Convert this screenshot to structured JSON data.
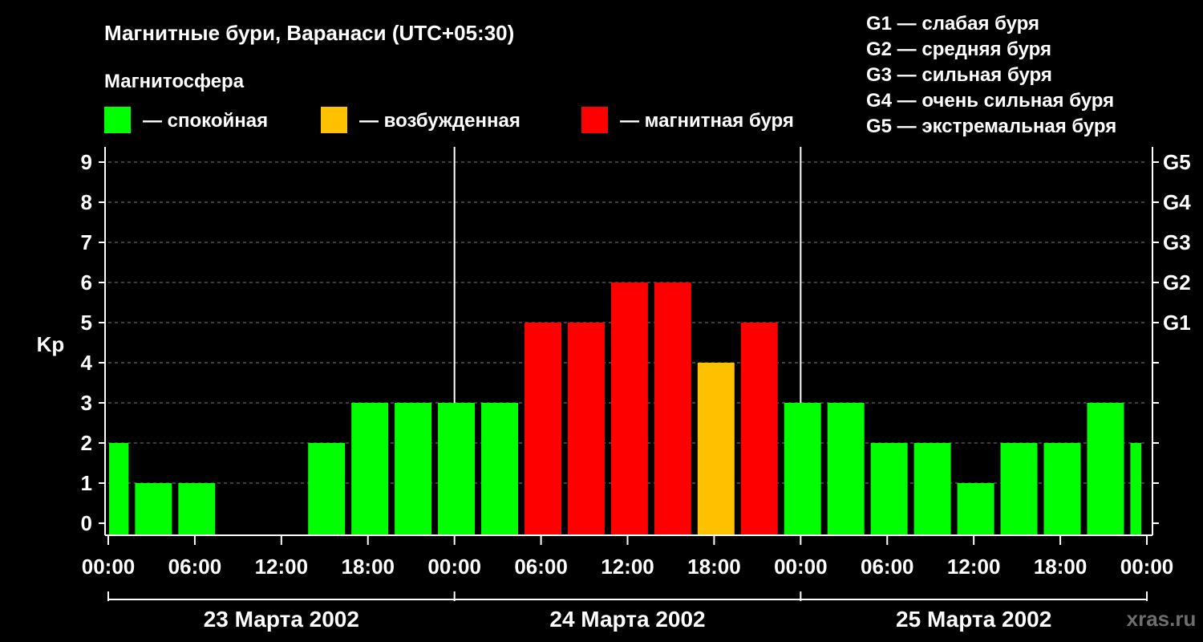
{
  "chart_data": {
    "type": "bar",
    "title": "Магнитные бури, Варанаси (UTC+05:30)",
    "subtitle": "Магнитосфера",
    "ylabel": "Kp",
    "ylim": [
      0,
      9
    ],
    "yticks": [
      "0",
      "1",
      "2",
      "3",
      "4",
      "5",
      "6",
      "7",
      "8",
      "9"
    ],
    "right_ticks": [
      {
        "kp": 5,
        "label": "G1"
      },
      {
        "kp": 6,
        "label": "G2"
      },
      {
        "kp": 7,
        "label": "G3"
      },
      {
        "kp": 8,
        "label": "G4"
      },
      {
        "kp": 9,
        "label": "G5"
      }
    ],
    "legend": [
      {
        "label": "— спокойная",
        "color": "#00ff00"
      },
      {
        "label": "— возбужденная",
        "color": "#ffc000"
      },
      {
        "label": "— магнитная буря",
        "color": "#ff0000"
      }
    ],
    "g_legend": [
      "G1 — слабая буря",
      "G2 — средняя буря",
      "G3 — сильная буря",
      "G4 — очень сильная буря",
      "G5 — экстремальная буря"
    ],
    "x_range_hours": [
      0,
      72
    ],
    "xticks": [
      "00:00",
      "06:00",
      "12:00",
      "18:00",
      "00:00",
      "06:00",
      "12:00",
      "18:00",
      "00:00",
      "06:00",
      "12:00",
      "18:00",
      "00:00"
    ],
    "days": [
      "23 Марта 2002",
      "24 Марта 2002",
      "25 Марта 2002"
    ],
    "bars": [
      {
        "start": 0,
        "end": 1.8,
        "kp": 2,
        "level": "quiet"
      },
      {
        "start": 1.8,
        "end": 4.8,
        "kp": 1,
        "level": "quiet"
      },
      {
        "start": 4.8,
        "end": 7.8,
        "kp": 1,
        "level": "quiet"
      },
      {
        "start": 7.8,
        "end": 10.8,
        "kp": 0,
        "level": "quiet"
      },
      {
        "start": 10.8,
        "end": 13.8,
        "kp": 0,
        "level": "quiet"
      },
      {
        "start": 13.8,
        "end": 16.8,
        "kp": 2,
        "level": "quiet"
      },
      {
        "start": 16.8,
        "end": 19.8,
        "kp": 3,
        "level": "quiet"
      },
      {
        "start": 19.8,
        "end": 22.8,
        "kp": 3,
        "level": "quiet"
      },
      {
        "start": 22.8,
        "end": 25.8,
        "kp": 3,
        "level": "quiet"
      },
      {
        "start": 25.8,
        "end": 28.8,
        "kp": 3,
        "level": "quiet"
      },
      {
        "start": 28.8,
        "end": 31.8,
        "kp": 5,
        "level": "storm"
      },
      {
        "start": 31.8,
        "end": 34.8,
        "kp": 5,
        "level": "storm"
      },
      {
        "start": 34.8,
        "end": 37.8,
        "kp": 6,
        "level": "storm"
      },
      {
        "start": 37.8,
        "end": 40.8,
        "kp": 6,
        "level": "storm"
      },
      {
        "start": 40.8,
        "end": 43.8,
        "kp": 4,
        "level": "active"
      },
      {
        "start": 43.8,
        "end": 46.8,
        "kp": 5,
        "level": "storm"
      },
      {
        "start": 46.8,
        "end": 49.8,
        "kp": 3,
        "level": "quiet"
      },
      {
        "start": 49.8,
        "end": 52.8,
        "kp": 3,
        "level": "quiet"
      },
      {
        "start": 52.8,
        "end": 55.8,
        "kp": 2,
        "level": "quiet"
      },
      {
        "start": 55.8,
        "end": 58.8,
        "kp": 2,
        "level": "quiet"
      },
      {
        "start": 58.8,
        "end": 61.8,
        "kp": 1,
        "level": "quiet"
      },
      {
        "start": 61.8,
        "end": 64.8,
        "kp": 2,
        "level": "quiet"
      },
      {
        "start": 64.8,
        "end": 67.8,
        "kp": 2,
        "level": "quiet"
      },
      {
        "start": 67.8,
        "end": 70.8,
        "kp": 3,
        "level": "quiet"
      },
      {
        "start": 70.8,
        "end": 72,
        "kp": 2,
        "level": "quiet"
      }
    ],
    "colors": {
      "quiet": "#00ff00",
      "active": "#ffc000",
      "storm": "#ff0000",
      "background": "#000000",
      "text": "#ffffff",
      "grid": "#808080"
    },
    "watermark": "xras.ru"
  }
}
